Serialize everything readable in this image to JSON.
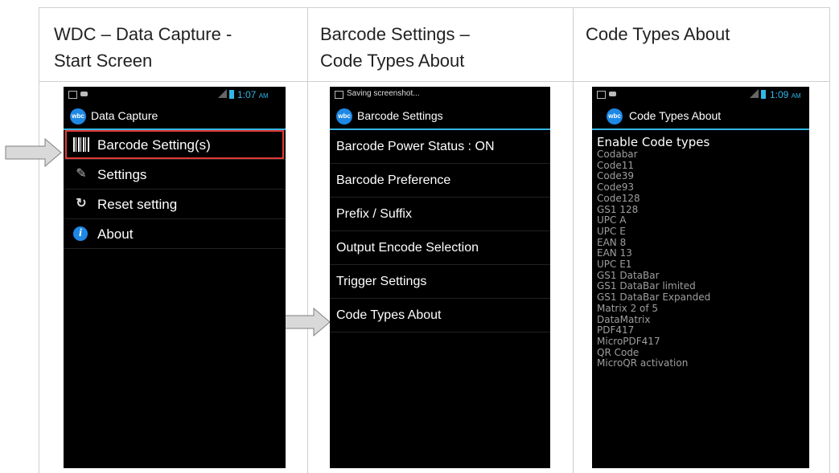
{
  "columns": [
    {
      "header_line1": "WDC – Data Capture -",
      "header_line2": "Start Screen"
    },
    {
      "header_line1": "Barcode Settings –",
      "header_line2": "Code Types About"
    },
    {
      "header_line1": "Code Types About",
      "header_line2": ""
    }
  ],
  "screen1": {
    "time": "1:07",
    "ampm": "AM",
    "app_icon": "wbc",
    "title": "Data Capture",
    "items": [
      {
        "label": "Barcode Setting(s)",
        "icon": "barcode-icon"
      },
      {
        "label": "Settings",
        "icon": "wrench-icon"
      },
      {
        "label": "Reset setting",
        "icon": "reset-icon"
      },
      {
        "label": "About",
        "icon": "info-icon"
      }
    ]
  },
  "screen2": {
    "status_text": "Saving screenshot...",
    "app_icon": "wbc",
    "title": "Barcode Settings",
    "items": [
      "Barcode Power Status : ON",
      "Barcode Preference",
      "Prefix / Suffix",
      "Output Encode Selection",
      "Trigger Settings",
      "Code Types About"
    ]
  },
  "screen3": {
    "time": "1:09",
    "ampm": "AM",
    "app_icon": "wbc",
    "title": "Code Types About",
    "list_title": "Enable Code types",
    "codes": [
      "Codabar",
      "Code11",
      "Code39",
      "Code93",
      "Code128",
      "GS1 128",
      "UPC A",
      "UPC E",
      "EAN 8",
      "EAN 13",
      "UPC E1",
      "GS1 DataBar",
      "GS1 DataBar limited",
      "GS1 DataBar Expanded",
      "Matrix 2 of 5",
      "DataMatrix",
      "PDF417",
      "MicroPDF417",
      "QR Code",
      "MicroQR activation"
    ]
  },
  "colors": {
    "accent": "#33b5e5",
    "highlight": "#e53935",
    "arrow_fill": "#d9d9d9",
    "arrow_stroke": "#808080"
  }
}
